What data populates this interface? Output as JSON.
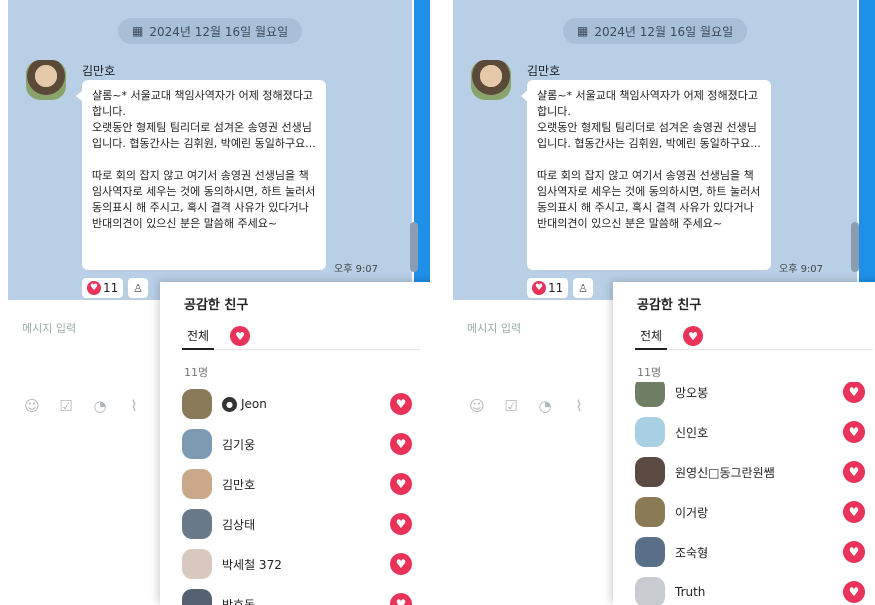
{
  "chat": {
    "date": "2024년 12월 16일 월요일",
    "sender": "김만호",
    "message": "샬롬~*  서울교대 책임사역자가 어제 정해졌다고 합니다.\n오랫동안 형제팀 팀리더로 섬겨온 송영권 선생님입니다. 협동간사는 김휘원, 박예린 동일하구요...\n\n따로 회의 잡지 않고 여기서 송영권 선생님을 책임사역자로 세우는 것에 동의하시면, 하트 눌러서 동의표시 해 주시고, 혹시 결격 사유가 있다거나 반대의견이 있으신 분은 말씀해 주세요~",
    "time": "오후 9:07",
    "reaction_count": "11",
    "input_placeholder": "메시지 입력"
  },
  "popup": {
    "title": "공감한 친구",
    "tab_all": "전체",
    "count_label": "11명",
    "left_list": [
      {
        "name": "Jeon",
        "badge": true
      },
      {
        "name": "김기웅"
      },
      {
        "name": "김만호"
      },
      {
        "name": "김상태"
      },
      {
        "name": "박세철 372"
      },
      {
        "name": "박호동"
      }
    ],
    "right_list": [
      {
        "name": "망오봉"
      },
      {
        "name": "신인호"
      },
      {
        "name": "원영신□동그란원쌤"
      },
      {
        "name": "이거랑"
      },
      {
        "name": "조숙형"
      },
      {
        "name": "Truth"
      }
    ]
  },
  "colors": {
    "chat_bg": "#b9cfe6",
    "accent_heart": "#e8335a",
    "desktop_blue": "#1e90e8"
  },
  "icons": [
    "calendar-icon",
    "heart-icon",
    "user-icon",
    "emoji-icon",
    "check-calendar-icon",
    "chat-bubble-icon",
    "paperclip-icon"
  ]
}
